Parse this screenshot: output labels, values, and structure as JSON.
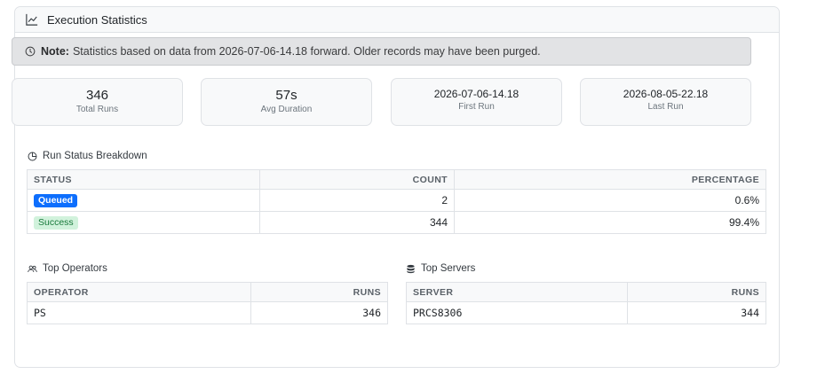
{
  "card": {
    "title": "Execution Statistics"
  },
  "note": {
    "label": "Note:",
    "text": "Statistics based on data from 2026-07-06-14.18 forward. Older records may have been purged."
  },
  "stats": [
    {
      "value": "346",
      "label": "Total Runs"
    },
    {
      "value": "57s",
      "label": "Avg Duration"
    },
    {
      "value": "2026-07-06-14.18",
      "label": "First Run"
    },
    {
      "value": "2026-08-05-22.18",
      "label": "Last Run"
    }
  ],
  "status_breakdown": {
    "title": "Run Status Breakdown",
    "headers": [
      "STATUS",
      "COUNT",
      "PERCENTAGE"
    ],
    "rows": [
      {
        "status": "Queued",
        "count": "2",
        "percentage": "0.6%",
        "color": "#0d6efd"
      },
      {
        "status": "Success",
        "count": "344",
        "percentage": "99.4%",
        "color": "#d1f2dc"
      }
    ]
  },
  "top_operators": {
    "title": "Top Operators",
    "headers": [
      "OPERATOR",
      "RUNS"
    ],
    "rows": [
      {
        "name": "PS",
        "runs": "346"
      }
    ]
  },
  "top_servers": {
    "title": "Top Servers",
    "headers": [
      "SERVER",
      "RUNS"
    ],
    "rows": [
      {
        "name": "PRCS8306",
        "runs": "344"
      }
    ]
  }
}
